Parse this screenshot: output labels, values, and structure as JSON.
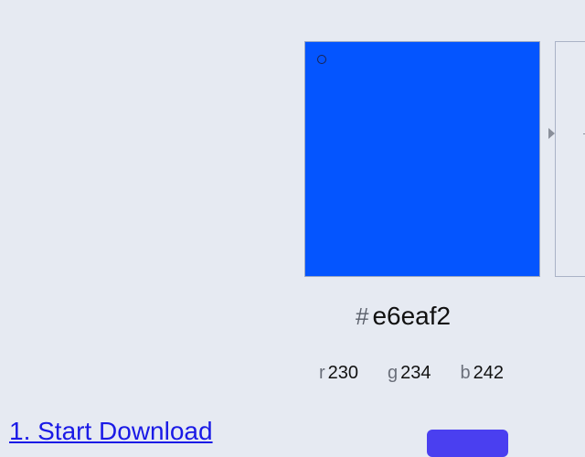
{
  "picker": {
    "panel_color": "#0455ff",
    "hex_hash": "#",
    "hex_value": "e6eaf2",
    "channels": [
      {
        "label": "r",
        "value": "230"
      },
      {
        "label": "g",
        "value": "234"
      },
      {
        "label": "b",
        "value": "242"
      }
    ]
  },
  "page": {
    "background": "#e6eaf2",
    "link_text": "1. Start Download",
    "button_color": "#4a3ff0",
    "button_label": ""
  },
  "icons": {
    "hue_arrow": "triangle-right-icon",
    "sv_cursor": "circle-cursor-icon"
  }
}
